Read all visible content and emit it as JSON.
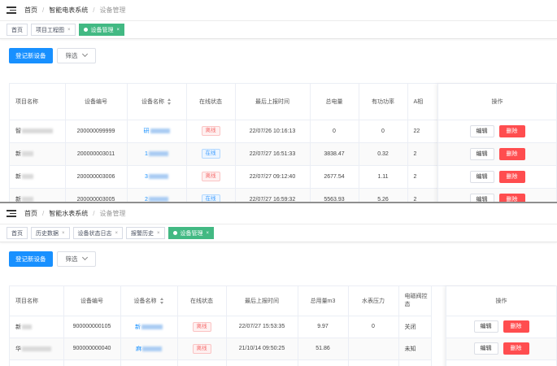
{
  "top": {
    "breadcrumb": [
      "首页",
      "智能电表系统",
      "设备管理"
    ],
    "tags": [
      {
        "label": "首页",
        "active": false,
        "closable": false
      },
      {
        "label": "项目工程图",
        "active": false,
        "closable": true
      },
      {
        "label": "设备管理",
        "active": true,
        "closable": true
      }
    ],
    "register_button": "登记新设备",
    "filter_button": "筛选",
    "columns": [
      "项目名称",
      "设备编号",
      "设备名称",
      "在线状态",
      "最后上报时间",
      "总电量",
      "有功功率",
      "A相"
    ],
    "op_header": "操作",
    "rows": [
      {
        "project": "智",
        "device_no": "200000099999",
        "device_name": "研",
        "status": "离线",
        "time": "22/07/26 10:16:13",
        "total": "0",
        "power": "0",
        "a_phase": "22"
      },
      {
        "project": "新",
        "device_no": "200000003011",
        "device_name": "1",
        "status": "在线",
        "time": "22/07/27 16:51:33",
        "total": "3838.47",
        "power": "0.32",
        "a_phase": "2"
      },
      {
        "project": "新",
        "device_no": "200000003006",
        "device_name": "3",
        "status": "离线",
        "time": "22/07/27 09:12:40",
        "total": "2677.54",
        "power": "1.11",
        "a_phase": "2"
      },
      {
        "project": "新",
        "device_no": "200000003005",
        "device_name": "2",
        "status": "在线",
        "time": "22/07/27 16:59:32",
        "total": "5563.93",
        "power": "5.26",
        "a_phase": "2"
      }
    ],
    "edit_label": "编辑",
    "delete_label": "删除"
  },
  "bottom": {
    "breadcrumb": [
      "首页",
      "智能水表系统",
      "设备管理"
    ],
    "tags": [
      {
        "label": "首页",
        "active": false,
        "closable": false
      },
      {
        "label": "历史数据",
        "active": false,
        "closable": true
      },
      {
        "label": "设备状态日志",
        "active": false,
        "closable": true
      },
      {
        "label": "报警历史",
        "active": false,
        "closable": true
      },
      {
        "label": "设备管理",
        "active": true,
        "closable": true
      }
    ],
    "register_button": "登记新设备",
    "filter_button": "筛选",
    "columns": [
      "项目名称",
      "设备编号",
      "设备名称",
      "在线状态",
      "最后上报时间",
      "总用量m3",
      "水表压力",
      "电磁阀控态"
    ],
    "op_header": "操作",
    "rows": [
      {
        "project": "新",
        "device_no": "900000000105",
        "device_name": "新",
        "status": "离线",
        "time": "22/07/27 15:53:35",
        "total": "9.97",
        "pressure": "0",
        "valve": "关闭"
      },
      {
        "project": "华",
        "device_no": "900000000040",
        "device_name": "麻",
        "status": "离线",
        "time": "21/10/14 09:50:25",
        "total": "51.86",
        "pressure": "",
        "valve": "未知"
      }
    ],
    "edit_label": "编辑",
    "delete_label": "删除"
  },
  "colors": {
    "primary": "#1890ff",
    "active_tag": "#42b983",
    "delete": "#ff4d4f",
    "offline": "#f56c6c",
    "online": "#409eff"
  }
}
